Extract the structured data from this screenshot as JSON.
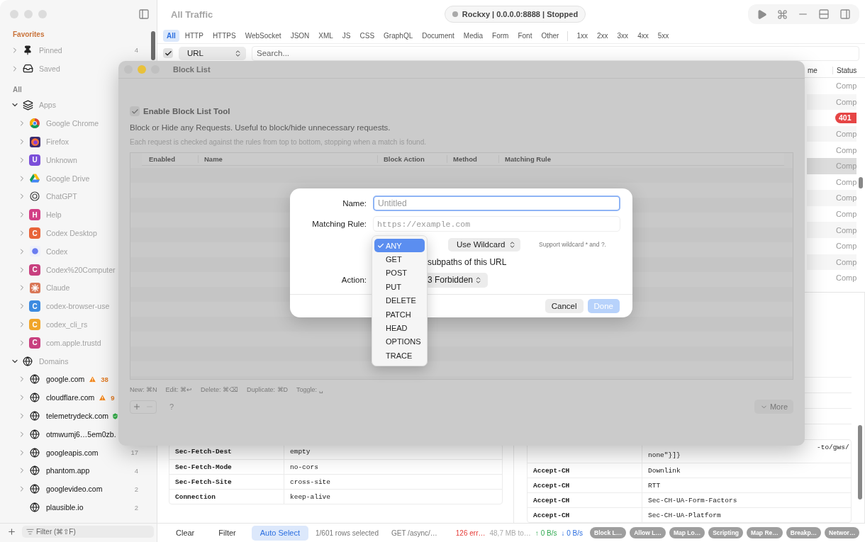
{
  "sidebar": {
    "sections": [
      {
        "title": "Favorites",
        "kind": "favorites",
        "items": [
          {
            "label": "Pinned",
            "kind": "pin",
            "count": "4",
            "expandable": true,
            "expanded": false
          },
          {
            "label": "Saved",
            "kind": "tray",
            "expandable": true,
            "expanded": false
          }
        ]
      },
      {
        "title": "All",
        "kind": "all",
        "items": [
          {
            "label": "Apps",
            "kind": "stack",
            "expandable": true,
            "expanded": true,
            "children": [
              {
                "label": "Google Chrome",
                "kind": "chrome",
                "expandable": true,
                "expanded": false
              },
              {
                "label": "Firefox",
                "kind": "firefox",
                "expandable": true,
                "expanded": false
              },
              {
                "label": "Unknown",
                "kind": "letter",
                "letter": "U",
                "color": "#7b4fd9",
                "expandable": true,
                "expanded": false
              },
              {
                "label": "Google Drive",
                "kind": "drive",
                "expandable": true,
                "expanded": false
              },
              {
                "label": "ChatGPT",
                "kind": "chatgpt",
                "expandable": true,
                "expanded": false
              },
              {
                "label": "Help",
                "kind": "letter",
                "letter": "H",
                "color": "#d23f85",
                "expandable": true,
                "expanded": false
              },
              {
                "label": "Codex Desktop",
                "kind": "letter",
                "letter": "C",
                "color": "#e8643a",
                "expandable": true,
                "expanded": false
              },
              {
                "label": "Codex",
                "kind": "codex",
                "expandable": true,
                "expanded": false
              },
              {
                "label": "Codex%20Computer",
                "kind": "letter",
                "letter": "C",
                "color": "#c8407f",
                "expandable": true,
                "expanded": false
              },
              {
                "label": "Claude",
                "kind": "claude",
                "expandable": true,
                "expanded": false
              },
              {
                "label": "codex-browser-use",
                "kind": "letter",
                "letter": "C",
                "color": "#3d8be0",
                "expandable": true,
                "expanded": false
              },
              {
                "label": "codex_cli_rs",
                "kind": "letter",
                "letter": "C",
                "color": "#f0a52a",
                "expandable": true,
                "expanded": false
              },
              {
                "label": "com.apple.trustd",
                "kind": "letter",
                "letter": "C",
                "color": "#c8407f",
                "expandable": true,
                "expanded": false
              }
            ]
          },
          {
            "label": "Domains",
            "kind": "globe",
            "expandable": true,
            "expanded": true,
            "children": [
              {
                "label": "google.com",
                "kind": "globe",
                "warning": true,
                "count": "38",
                "expandable": true,
                "expanded": false
              },
              {
                "label": "cloudflare.com",
                "kind": "globe",
                "warning": true,
                "count": "9",
                "expandable": true,
                "expanded": false
              },
              {
                "label": "telemetrydeck.com",
                "kind": "globe",
                "verified": true,
                "expandable": true,
                "expanded": false
              },
              {
                "label": "otmwumj6…5em0zb.",
                "kind": "globe",
                "expandable": true,
                "expanded": false
              },
              {
                "label": "googleapis.com",
                "kind": "globe",
                "count": "17",
                "expandable": true,
                "expanded": false
              },
              {
                "label": "phantom.app",
                "kind": "globe",
                "count": "4",
                "expandable": true,
                "expanded": false
              },
              {
                "label": "googlevideo.com",
                "kind": "globe",
                "count": "2",
                "expandable": true,
                "expanded": false
              },
              {
                "label": "plausible.io",
                "kind": "globe",
                "count": "2",
                "expandable": false
              }
            ]
          }
        ]
      }
    ],
    "filter": {
      "placeholder": "Filter (⌘⇧F)"
    }
  },
  "toolbar": {
    "title": "All Traffic",
    "status": "Rockxy | 0.0.0.0:8888 | Stopped",
    "running": false
  },
  "filters": {
    "types": [
      {
        "label": "All",
        "selected": true
      },
      {
        "label": "HTTP",
        "selected": false
      },
      {
        "label": "HTTPS",
        "selected": false
      },
      {
        "label": "WebSocket",
        "selected": false
      },
      {
        "label": "JSON",
        "selected": false
      },
      {
        "label": "XML",
        "selected": false
      },
      {
        "label": "JS",
        "selected": false
      },
      {
        "label": "CSS",
        "selected": false
      },
      {
        "label": "GraphQL",
        "selected": false
      },
      {
        "label": "Document",
        "selected": false
      },
      {
        "label": "Media",
        "selected": false
      },
      {
        "label": "Form",
        "selected": false
      },
      {
        "label": "Font",
        "selected": false
      },
      {
        "label": "Other",
        "selected": false
      }
    ],
    "status_classes": [
      {
        "label": "1xx",
        "selected": false
      },
      {
        "label": "2xx",
        "selected": false
      },
      {
        "label": "3xx",
        "selected": false
      },
      {
        "label": "4xx",
        "selected": false
      },
      {
        "label": "5xx",
        "selected": false
      }
    ]
  },
  "search": {
    "enabled": true,
    "field": "URL",
    "placeholder": "Search..."
  },
  "requests": {
    "columns": [
      "me",
      "Status"
    ],
    "rows": [
      {
        "status": "Comp",
        "kind": "text",
        "selected": false
      },
      {
        "status": "Comp",
        "kind": "text",
        "selected": false
      },
      {
        "status": "401",
        "kind": "error",
        "selected": false
      },
      {
        "status": "Comp",
        "kind": "text",
        "selected": false
      },
      {
        "status": "Comp",
        "kind": "text",
        "selected": false
      },
      {
        "status": "Comp",
        "kind": "text",
        "selected": true
      },
      {
        "status": "Comp",
        "kind": "text",
        "selected": false
      },
      {
        "status": "Comp",
        "kind": "text",
        "selected": false
      },
      {
        "status": "Comp",
        "kind": "text",
        "selected": false
      },
      {
        "status": "Comp",
        "kind": "text",
        "selected": false
      },
      {
        "status": "Comp",
        "kind": "text",
        "selected": false
      },
      {
        "status": "Comp",
        "kind": "text",
        "selected": false
      },
      {
        "status": "Comp",
        "kind": "text",
        "selected": false
      }
    ]
  },
  "request_headers": {
    "rows": [
      {
        "name": "Sec-Fetch-Dest",
        "value": "empty"
      },
      {
        "name": "Sec-Fetch-Mode",
        "value": "no-cors"
      },
      {
        "name": "Sec-Fetch-Site",
        "value": "cross-site"
      },
      {
        "name": "Connection",
        "value": "keep-alive"
      }
    ]
  },
  "response_headers": {
    "continued": {
      "line_1": "-to/gws/",
      "line_2": "none\"}]}"
    },
    "rows": [
      {
        "name": "Accept-CH",
        "value": "Downlink"
      },
      {
        "name": "Accept-CH",
        "value": "RTT"
      },
      {
        "name": "Accept-CH",
        "value": "Sec-CH-UA-Form-Factors"
      },
      {
        "name": "Accept-CH",
        "value": "Sec-CH-UA-Platform"
      }
    ]
  },
  "status_bar": {
    "buttons": [
      {
        "label": "Clear",
        "selected": false
      },
      {
        "label": "Filter",
        "selected": false
      },
      {
        "label": "Auto Select",
        "selected": true
      }
    ],
    "selection": "1/601 rows selected",
    "request": "GET /async/…",
    "errors": "126 err…",
    "traffic": "48,7 MB to…",
    "upload": "↑ 0 B/s",
    "download": "↓ 0 B/s",
    "tools": [
      "Block L…",
      "Allow L…",
      "Map Lo…",
      "Scripting",
      "Map Re…",
      "Breakp…",
      "Networ…"
    ]
  },
  "block_list": {
    "title": "Block List",
    "enabled": true,
    "enable_label": "Enable Block List Tool",
    "description": "Block or Hide any Requests. Useful to block/hide unnecessary requests.",
    "hint": "Each request is checked against the rules from top to bottom, stopping when a match is found.",
    "columns": [
      "Enabled",
      "Name",
      "Block Action",
      "Method",
      "Matching Rule"
    ],
    "shortcuts": [
      "New: ⌘N",
      "Edit: ⌘↩",
      "Delete: ⌘⌫",
      "Duplicate: ⌘D",
      "Toggle: ␣"
    ],
    "help": "?",
    "more": "More"
  },
  "rule_sheet": {
    "fields": [
      {
        "label": "Name:",
        "placeholder": "Untitled",
        "kind": "text",
        "focused": true
      },
      {
        "label": "Matching Rule:",
        "placeholder": "https://example.com",
        "kind": "mono",
        "focused": false
      }
    ],
    "match_mode": "Use Wildcard",
    "match_hint": "Support wildcard * and ?.",
    "include_text": "subpaths of this URL",
    "action_label": "Action:",
    "action": "3 Forbidden",
    "buttons": [
      {
        "label": "Cancel",
        "kind": "secondary",
        "disabled": false
      },
      {
        "label": "Done",
        "kind": "primary",
        "disabled": true
      }
    ]
  },
  "method_menu": {
    "items": [
      {
        "label": "ANY",
        "selected": true
      },
      {
        "label": "GET",
        "selected": false
      },
      {
        "label": "POST",
        "selected": false
      },
      {
        "label": "PUT",
        "selected": false
      },
      {
        "label": "DELETE",
        "selected": false
      },
      {
        "label": "PATCH",
        "selected": false
      },
      {
        "label": "HEAD",
        "selected": false
      },
      {
        "label": "OPTIONS",
        "selected": false
      },
      {
        "label": "TRACE",
        "selected": false
      }
    ]
  }
}
